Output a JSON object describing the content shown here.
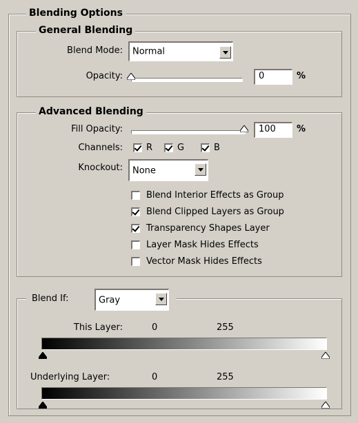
{
  "blending_options": {
    "title": "Blending Options"
  },
  "general_blending": {
    "title": "General Blending",
    "blend_mode_label": "Blend Mode:",
    "blend_mode_value": "Normal",
    "opacity_label": "Opacity:",
    "opacity_value": "0",
    "opacity_unit": "%",
    "opacity_level": 0
  },
  "advanced_blending": {
    "title": "Advanced Blending",
    "fill_opacity_label": "Fill Opacity:",
    "fill_opacity_value": "100",
    "fill_opacity_unit": "%",
    "fill_opacity_level": 100,
    "channels_label": "Channels:",
    "channels": [
      {
        "label": "R",
        "checked": true
      },
      {
        "label": "G",
        "checked": true
      },
      {
        "label": "B",
        "checked": true
      }
    ],
    "knockout_label": "Knockout:",
    "knockout_value": "None",
    "options": [
      {
        "label": "Blend Interior Effects as Group",
        "checked": false
      },
      {
        "label": "Blend Clipped Layers as Group",
        "checked": true
      },
      {
        "label": "Transparency Shapes Layer",
        "checked": true
      },
      {
        "label": "Layer Mask Hides Effects",
        "checked": false
      },
      {
        "label": "Vector Mask Hides Effects",
        "checked": false
      }
    ]
  },
  "blend_if": {
    "label": "Blend If:",
    "value": "Gray",
    "this_layer_label": "This Layer:",
    "this_layer_min": "0",
    "this_layer_max": "255",
    "underlying_layer_label": "Underlying Layer:",
    "underlying_layer_min": "0",
    "underlying_layer_max": "255"
  },
  "colors": {
    "panel": "#d4d0c8",
    "border": "#8f8b82"
  }
}
